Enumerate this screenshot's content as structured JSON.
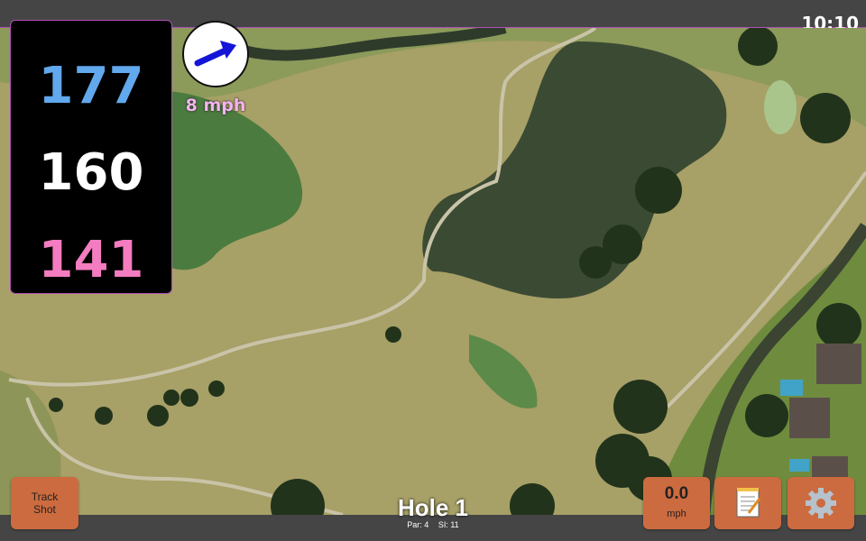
{
  "status_bar": {
    "time": "10:10"
  },
  "distances": {
    "back": "177",
    "middle": "160",
    "front": "141"
  },
  "wind": {
    "direction_icon": "arrow-right-icon",
    "speed": "8 mph"
  },
  "hole": {
    "title": "Hole 1",
    "par": "Par: 4",
    "stroke_index": "SI: 11"
  },
  "buttons": {
    "track_shot_line1": "Track",
    "track_shot_line2": "Shot",
    "speed_value": "0.0",
    "speed_unit": "mph",
    "notes_icon": "notepad-icon",
    "settings_icon": "gear-icon"
  },
  "colors": {
    "back": "#61a8ec",
    "middle": "#ffffff",
    "front": "#f47cc0",
    "accent_button": "#cc6b3f",
    "wind_text": "#f5b3ef"
  }
}
